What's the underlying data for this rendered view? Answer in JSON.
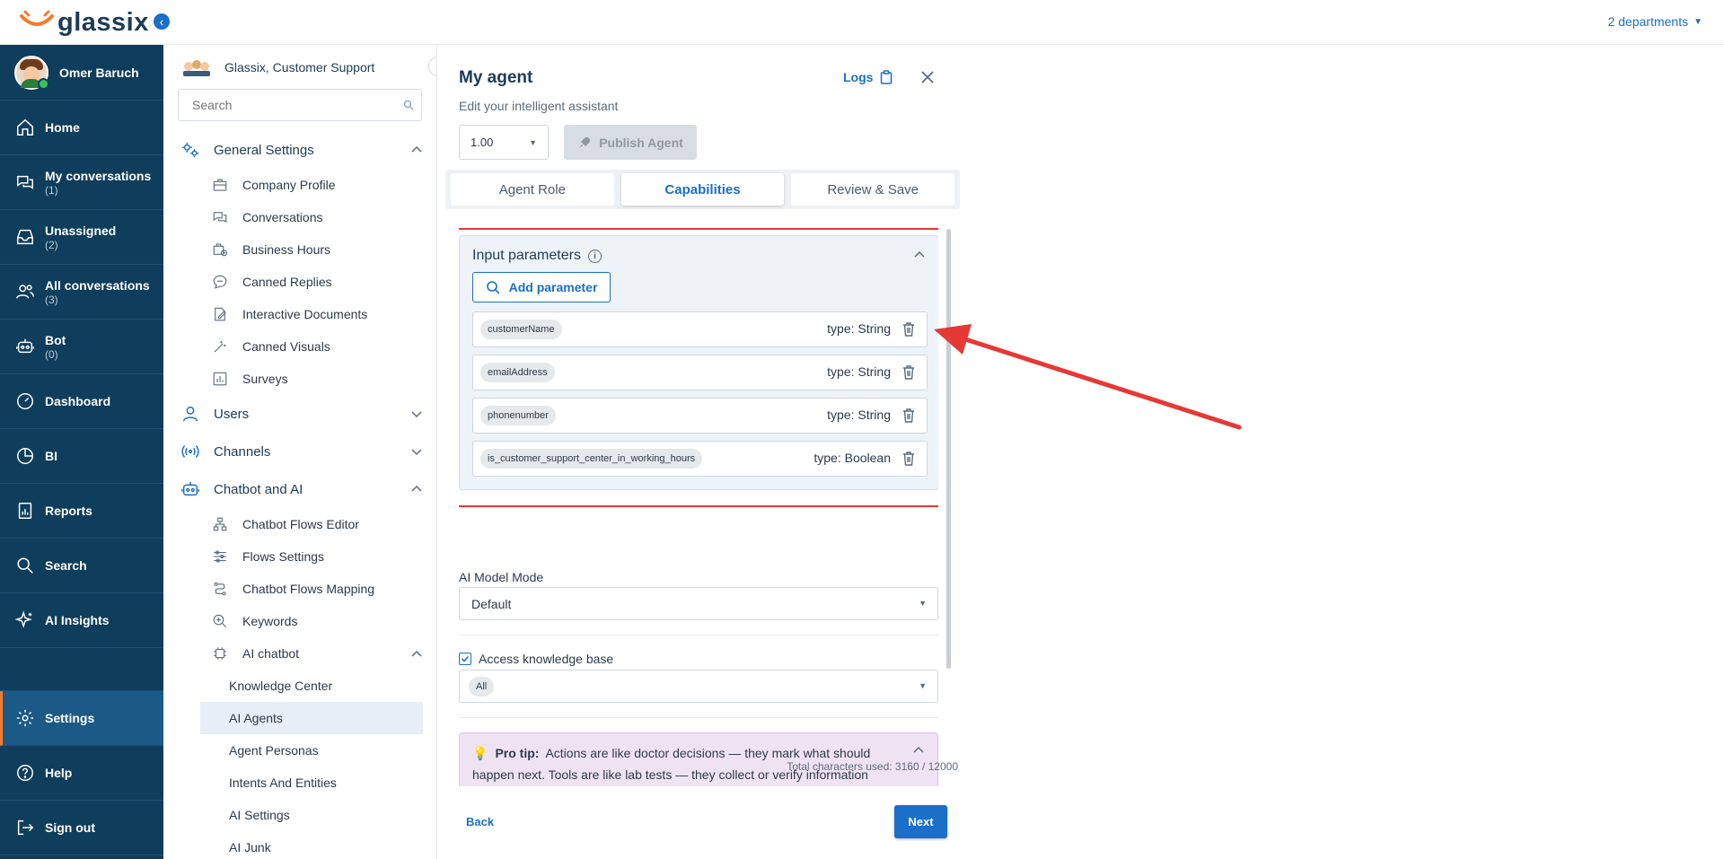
{
  "header": {
    "brand": "glassix",
    "departments_label": "2 departments"
  },
  "sidenav": {
    "user_name": "Omer Baruch",
    "items": [
      {
        "label": "Home",
        "count": ""
      },
      {
        "label": "My conversations",
        "count": "(1)"
      },
      {
        "label": "Unassigned",
        "count": "(2)"
      },
      {
        "label": "All conversations",
        "count": "(3)"
      },
      {
        "label": "Bot",
        "count": "(0)"
      },
      {
        "label": "Dashboard",
        "count": ""
      },
      {
        "label": "BI",
        "count": ""
      },
      {
        "label": "Reports",
        "count": ""
      },
      {
        "label": "Search",
        "count": ""
      },
      {
        "label": "AI Insights",
        "count": ""
      },
      {
        "label": "Settings",
        "count": ""
      },
      {
        "label": "Help",
        "count": ""
      },
      {
        "label": "Sign out",
        "count": ""
      }
    ]
  },
  "settings_panel": {
    "org_name": "Glassix, Customer Support",
    "search_placeholder": "Search",
    "general": {
      "label": "General Settings",
      "items": [
        "Company Profile",
        "Conversations",
        "Business Hours",
        "Canned Replies",
        "Interactive Documents",
        "Canned Visuals",
        "Surveys"
      ]
    },
    "users_label": "Users",
    "channels_label": "Channels",
    "chatbot": {
      "label": "Chatbot and AI",
      "items": [
        "Chatbot Flows Editor",
        "Flows Settings",
        "Chatbot Flows Mapping",
        "Keywords"
      ],
      "ai_chatbot_label": "AI chatbot",
      "ai_items": [
        "Knowledge Center",
        "AI Agents",
        "Agent Personas",
        "Intents And Entities",
        "AI Settings",
        "AI Junk"
      ]
    }
  },
  "editor": {
    "title": "My agent",
    "subtitle": "Edit your intelligent assistant",
    "logs_label": "Logs",
    "version": "1.00",
    "publish_label": "Publish Agent",
    "tabs": [
      "Agent Role",
      "Capabilities",
      "Review & Save"
    ],
    "input_params": {
      "title": "Input parameters",
      "add_label": "Add parameter",
      "rows": [
        {
          "name": "customerName",
          "type": "type: String"
        },
        {
          "name": "emailAddress",
          "type": "type: String"
        },
        {
          "name": "phonenumber",
          "type": "type: String"
        },
        {
          "name": "is_customer_support_center_in_working_hours",
          "type": "type: Boolean"
        }
      ]
    },
    "model_mode_label": "AI Model Mode",
    "model_mode_value": "Default",
    "knowledge_label": "Access knowledge base",
    "knowledge_value": "All",
    "protip_title": "Pro tip:",
    "protip_text": "Actions are like doctor decisions — they mark what should happen next. Tools are like lab tests — they collect or verify information",
    "chars_used": "Total characters used: 3160 / 12000",
    "back_label": "Back",
    "next_label": "Next"
  },
  "colors": {
    "nav_bg": "#0f3d5c",
    "accent": "#1a6fc9",
    "highlight": "#e53935",
    "active_marker": "#f57b2b"
  }
}
